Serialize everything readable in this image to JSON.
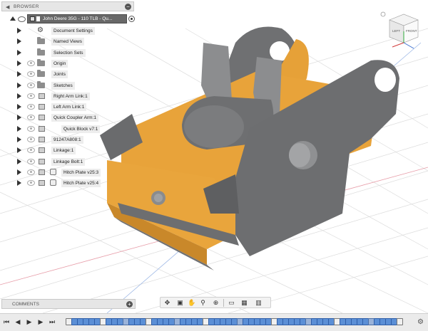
{
  "browser": {
    "title": "BROWSER",
    "root": "John Deere 35G - 110 TLB - Qu...",
    "items": [
      {
        "label": "Document Settings",
        "icon": "gear",
        "eye": false
      },
      {
        "label": "Named Views",
        "icon": "folder",
        "eye": false
      },
      {
        "label": "Selection Sets",
        "icon": "folder",
        "eye": false
      },
      {
        "label": "Origin",
        "icon": "folder",
        "eye": true
      },
      {
        "label": "Joints",
        "icon": "folder",
        "eye": true
      },
      {
        "label": "Sketches",
        "icon": "folder",
        "eye": true
      },
      {
        "label": "Right Arm Link:1",
        "icon": "component",
        "eye": true
      },
      {
        "label": "Left Arm Link:1",
        "icon": "component",
        "eye": true
      },
      {
        "label": "Quick Coupler Arm:1",
        "icon": "component",
        "eye": true
      },
      {
        "label": "Quick Block v7:1",
        "icon": "linked",
        "eye": true
      },
      {
        "label": "91247A808:1",
        "icon": "component",
        "eye": true
      },
      {
        "label": "Linkage:1",
        "icon": "component",
        "eye": true
      },
      {
        "label": "Linkage Bolt:1",
        "icon": "component",
        "eye": true
      },
      {
        "label": "Hitch Plate v25:3",
        "icon": "linked",
        "eye": true
      },
      {
        "label": "Hitch Plate v25:4",
        "icon": "linked",
        "eye": true
      }
    ]
  },
  "viewcube": {
    "left": "LEFT",
    "front": "FRONT"
  },
  "comments": {
    "title": "COMMENTS"
  },
  "colors": {
    "orange": "#e8a33a",
    "gray": "#6d6e70",
    "grid": "#d9d9d9"
  }
}
